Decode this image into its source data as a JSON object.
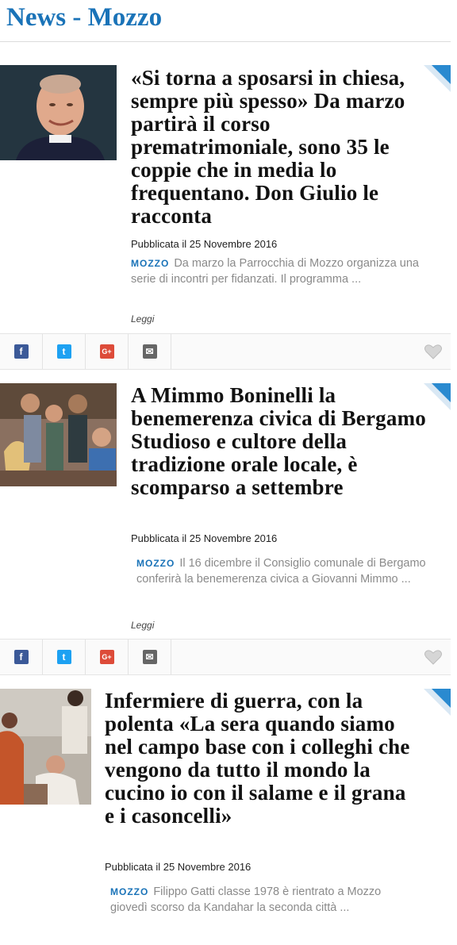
{
  "header": {
    "title": "News - Mozzo"
  },
  "articles": [
    {
      "title": "«Si torna a sposarsi in chiesa, sempre più spesso» Da marzo partirà il corso prematrimoniale, sono 35 le coppie che in media lo frequentano. Don Giulio le racconta",
      "date": "Pubblicata il 25 Novembre 2016",
      "tag": "MOZZO",
      "excerpt": "Da marzo la Parrocchia di Mozzo organizza una serie di incontri per fidanzati. Il programma ...",
      "read_more": "Leggi"
    },
    {
      "title": "A Mimmo Boninelli la benemerenza civica di Bergamo Studioso e cultore della tradizione orale locale, è scomparso a settembre",
      "date": "Pubblicata il 25 Novembre 2016",
      "tag": "MOZZO",
      "excerpt": "Il 16 dicembre il Consiglio comunale di Bergamo conferirà la benemerenza civica a Giovanni Mimmo ...",
      "read_more": "Leggi"
    },
    {
      "title": "Infermiere di guerra, con la polenta «La sera quando siamo nel campo base con i colleghi che vengono da tutto il mondo la cucino io con il salame e il grana e i casoncelli»",
      "date": "Pubblicata il 25 Novembre 2016",
      "tag": "MOZZO",
      "excerpt": "Filippo Gatti classe 1978 è rientrato a Mozzo giovedì scorso da Kandahar la seconda città ..."
    }
  ],
  "share": {
    "facebook_icon": "f",
    "twitter_icon": "t",
    "googleplus_icon": "G+",
    "email_icon": "✉"
  },
  "colors": {
    "accent": "#1a73b8",
    "facebook": "#3b5998",
    "twitter": "#1da1f2",
    "googleplus": "#dd4b39",
    "email": "#666666"
  }
}
